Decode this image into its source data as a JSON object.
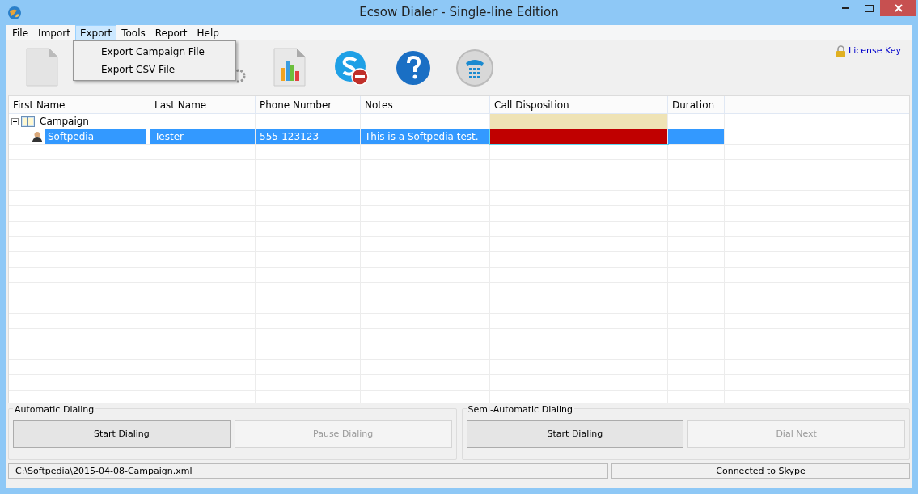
{
  "window": {
    "title": "Ecsow Dialer - Single-line Edition"
  },
  "menu": [
    {
      "label": "File",
      "selected": false
    },
    {
      "label": "Import",
      "selected": false
    },
    {
      "label": "Export",
      "selected": true
    },
    {
      "label": "Tools",
      "selected": false
    },
    {
      "label": "Report",
      "selected": false
    },
    {
      "label": "Help",
      "selected": false
    }
  ],
  "open_menu": {
    "items": [
      "Export Campaign File",
      "Export CSV File"
    ]
  },
  "license_link": "License Key",
  "table": {
    "columns": [
      "First Name",
      "Last Name",
      "Phone Number",
      "Notes",
      "Call Disposition",
      "Duration"
    ],
    "rows": [
      {
        "kind": "campaign",
        "expanded": true,
        "selected": false,
        "cells": [
          "Campaign",
          "",
          "",
          "",
          "",
          ""
        ],
        "color": "#efe3b5",
        "children": [
          {
            "kind": "contact",
            "selected": true,
            "cells": [
              "Softpedia",
              "Tester",
              "555-123123",
              "This is a Softpedia test.",
              "",
              ""
            ],
            "color": "#c00000"
          }
        ]
      }
    ]
  },
  "groups": [
    {
      "title": "Automatic Dialing",
      "buttons": [
        {
          "label": "Start Dialing",
          "disabled": false
        },
        {
          "label": "Pause Dialing",
          "disabled": true
        }
      ]
    },
    {
      "title": "Semi-Automatic Dialing",
      "buttons": [
        {
          "label": "Start Dialing",
          "disabled": false
        },
        {
          "label": "Dial Next",
          "disabled": true
        }
      ]
    }
  ],
  "status_bar": [
    "C:\\Softpedia\\2015-04-08-Campaign.xml",
    "Connected to Skype"
  ]
}
